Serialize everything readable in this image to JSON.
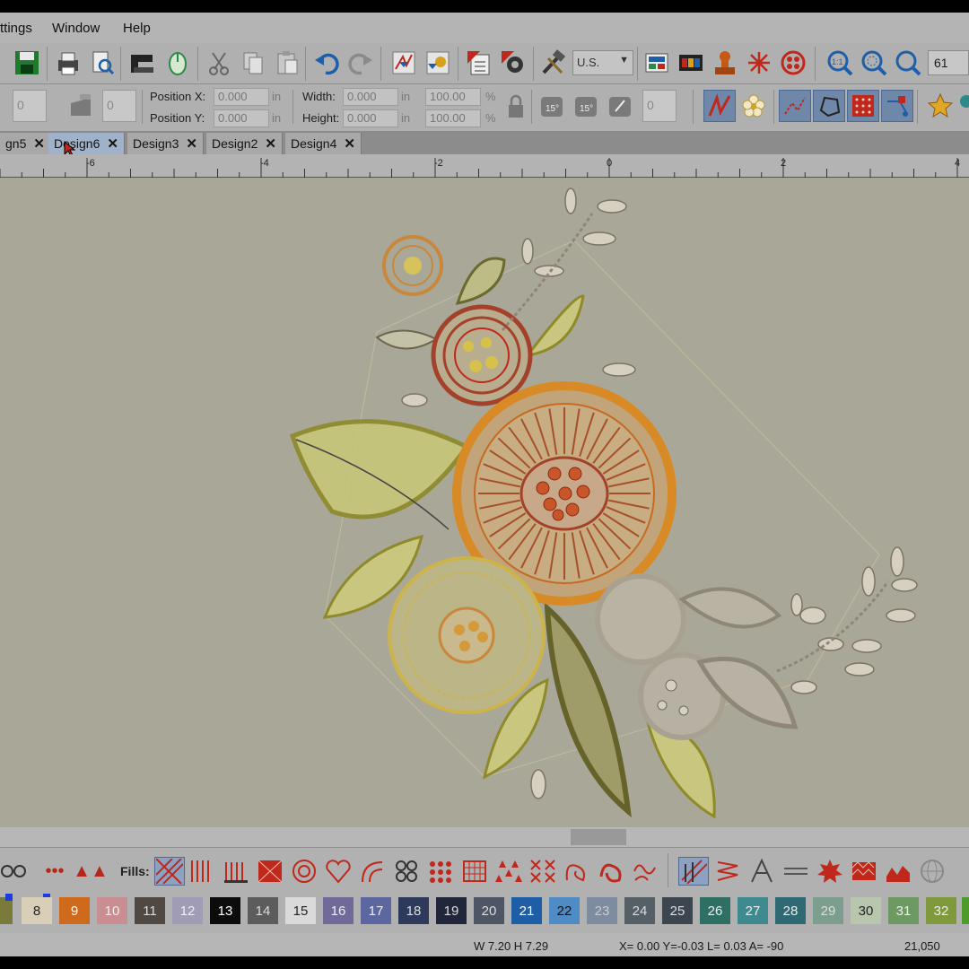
{
  "menu": {
    "items": [
      "ttings",
      "Window",
      "Help"
    ]
  },
  "toolbar": {
    "measure_select": "U.S.",
    "zoom_value": "61",
    "icons": [
      "save-icon",
      "print-icon",
      "print-preview-icon",
      "machine-icon",
      "mouse-icon",
      "cut-icon",
      "copy-icon",
      "paste-icon",
      "undo-icon",
      "redo-icon",
      "convert-icon",
      "wizard-icon",
      "properties-icon",
      "settings-icon",
      "tools-icon"
    ]
  },
  "position": {
    "x_label": "Position X:",
    "x_value": "0.000",
    "x_unit": "in",
    "y_label": "Position Y:",
    "y_value": "0.000",
    "y_unit": "in"
  },
  "size": {
    "w_label": "Width:",
    "w_value": "0.000",
    "w_unit": "in",
    "w_pct": "100.00",
    "w_pct_unit": "%",
    "h_label": "Height:",
    "h_value": "0.000",
    "h_unit": "in",
    "h_pct": "100.00",
    "h_pct_unit": "%"
  },
  "spinners": {
    "rotate1": "0",
    "rotate2": "0",
    "angle": "0"
  },
  "rotate_labels": {
    "r1": "15°",
    "r2": "15°"
  },
  "tabs": [
    {
      "label": "gn5",
      "close": "✕"
    },
    {
      "label": "Design6",
      "close": "✕"
    },
    {
      "label": "Design3",
      "close": "✕"
    },
    {
      "label": "Design2",
      "close": "✕"
    },
    {
      "label": "Design4",
      "close": "✕"
    }
  ],
  "ruler": {
    "labels": [
      "-6",
      "-4",
      "-2",
      "0",
      "2",
      "4"
    ]
  },
  "fills": {
    "label": "Fills:"
  },
  "colors": [
    {
      "n": "8",
      "bg": "#d9cfb8",
      "fg": "#222"
    },
    {
      "n": "9",
      "bg": "#cf6a1c",
      "fg": "#fff"
    },
    {
      "n": "10",
      "bg": "#c98e92",
      "fg": "#eee"
    },
    {
      "n": "11",
      "bg": "#4f4843",
      "fg": "#ddd"
    },
    {
      "n": "12",
      "bg": "#a09cb6",
      "fg": "#eee"
    },
    {
      "n": "13",
      "bg": "#0c0c0c",
      "fg": "#fff"
    },
    {
      "n": "14",
      "bg": "#5c5c5c",
      "fg": "#ddd"
    },
    {
      "n": "15",
      "bg": "#dadada",
      "fg": "#222"
    },
    {
      "n": "16",
      "bg": "#6f6a9a",
      "fg": "#eee"
    },
    {
      "n": "17",
      "bg": "#5b679e",
      "fg": "#eee"
    },
    {
      "n": "18",
      "bg": "#2e3a5c",
      "fg": "#ddd"
    },
    {
      "n": "19",
      "bg": "#22263a",
      "fg": "#ddd"
    },
    {
      "n": "20",
      "bg": "#4e5565",
      "fg": "#ddd"
    },
    {
      "n": "21",
      "bg": "#1d5ea6",
      "fg": "#fff"
    },
    {
      "n": "22",
      "bg": "#4f8cc6",
      "fg": "#111"
    },
    {
      "n": "23",
      "bg": "#7d8ca0",
      "fg": "#ccc"
    },
    {
      "n": "24",
      "bg": "#555f66",
      "fg": "#ddd"
    },
    {
      "n": "25",
      "bg": "#3c4650",
      "fg": "#ddd"
    },
    {
      "n": "26",
      "bg": "#2d6f62",
      "fg": "#eee"
    },
    {
      "n": "27",
      "bg": "#3e8a8e",
      "fg": "#eee"
    },
    {
      "n": "28",
      "bg": "#2f6a74",
      "fg": "#eee"
    },
    {
      "n": "29",
      "bg": "#7c9e8e",
      "fg": "#ddd"
    },
    {
      "n": "30",
      "bg": "#b8c6ae",
      "fg": "#222"
    },
    {
      "n": "31",
      "bg": "#6c9a62",
      "fg": "#eee"
    },
    {
      "n": "32",
      "bg": "#7f9a3c",
      "fg": "#eee"
    }
  ],
  "status": {
    "size": "W 7.20 H 7.29",
    "coords": "X= 0.00 Y=-0.03 L= 0.03 A= -90",
    "stitches": "21,050"
  }
}
